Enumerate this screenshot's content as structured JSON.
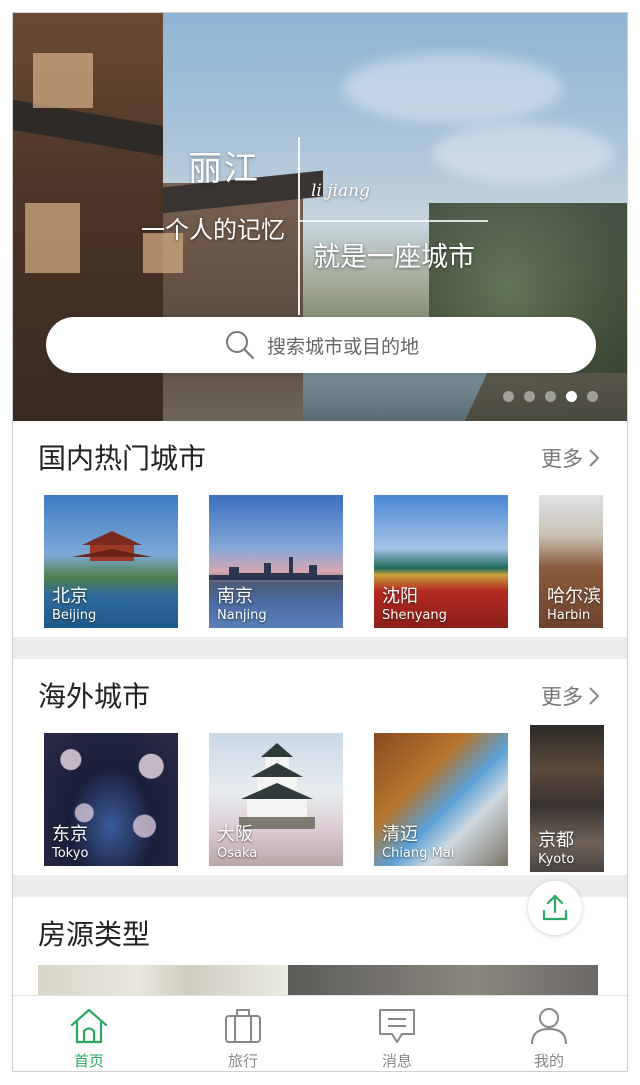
{
  "hero": {
    "title": "丽江",
    "pinyin": "li jiang",
    "line1": "一个人的记忆",
    "line2": "就是一座城市",
    "carousel_count": 5,
    "carousel_active_index": 3
  },
  "search": {
    "placeholder": "搜索城市或目的地"
  },
  "domestic": {
    "title": "国内热门城市",
    "more": "更多",
    "cities": [
      {
        "cn": "北京",
        "en": "Beijing"
      },
      {
        "cn": "南京",
        "en": "Nanjing"
      },
      {
        "cn": "沈阳",
        "en": "Shenyang"
      },
      {
        "cn": "哈尔滨",
        "en": "Harbin"
      }
    ]
  },
  "overseas": {
    "title": "海外城市",
    "more": "更多",
    "cities": [
      {
        "cn": "东京",
        "en": "Tokyo"
      },
      {
        "cn": "大阪",
        "en": "Osaka"
      },
      {
        "cn": "清迈",
        "en": "Chiang Mai"
      },
      {
        "cn": "京都",
        "en": "Kyoto"
      }
    ]
  },
  "housing": {
    "title": "房源类型"
  },
  "tabs": [
    {
      "label": "首页",
      "icon": "home-icon",
      "active": true
    },
    {
      "label": "旅行",
      "icon": "suitcase-icon",
      "active": false
    },
    {
      "label": "消息",
      "icon": "message-icon",
      "active": false
    },
    {
      "label": "我的",
      "icon": "user-icon",
      "active": false
    }
  ],
  "colors": {
    "accent": "#2aa862",
    "inactive": "#888888",
    "separator": "#ededed"
  }
}
